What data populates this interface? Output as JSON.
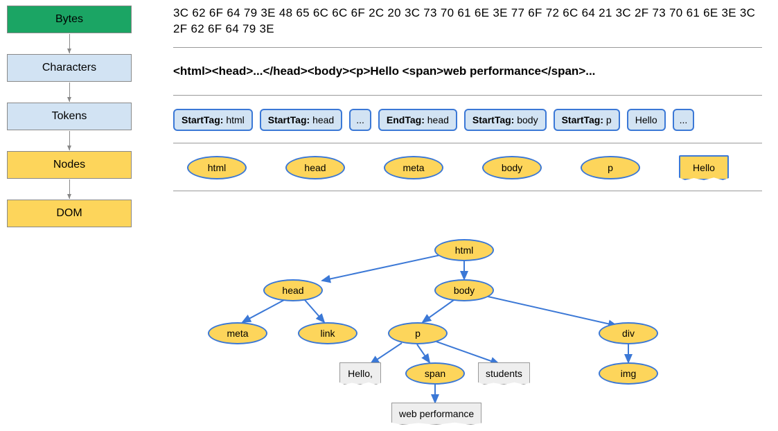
{
  "stages": {
    "bytes": "Bytes",
    "characters": "Characters",
    "tokens": "Tokens",
    "nodes": "Nodes",
    "dom": "DOM"
  },
  "bytes_hex": "3C 62 6F 64 79 3E 48 65 6C 6C 6F 2C 20 3C 73 70 61 6E 3E 77 6F 72 6C 64 21 3C 2F 73 70 61 6E 3E 3C 2F 62 6F 64 79 3E",
  "characters_string": "<html><head>...</head><body><p>Hello <span>web performance</span>...",
  "tokens": [
    {
      "prefix": "StartTag:",
      "value": "html"
    },
    {
      "prefix": "StartTag:",
      "value": "head"
    },
    {
      "prefix": "",
      "value": "..."
    },
    {
      "prefix": "EndTag:",
      "value": "head"
    },
    {
      "prefix": "StartTag:",
      "value": "body"
    },
    {
      "prefix": "StartTag:",
      "value": "p"
    },
    {
      "prefix": "",
      "value": "Hello"
    },
    {
      "prefix": "",
      "value": "..."
    }
  ],
  "node_list": [
    "html",
    "head",
    "meta",
    "body",
    "p"
  ],
  "node_text": "Hello",
  "tree": {
    "html": "html",
    "head": "head",
    "body": "body",
    "meta": "meta",
    "link": "link",
    "p": "p",
    "div": "div",
    "span": "span",
    "img": "img",
    "hello": "Hello,",
    "students": "students",
    "webperf": "web performance"
  }
}
